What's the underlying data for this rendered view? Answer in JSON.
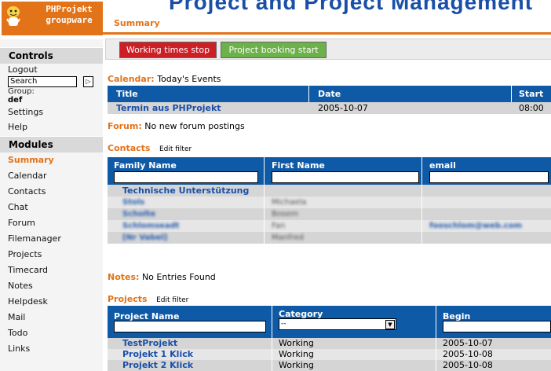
{
  "logo": {
    "line1": "PHProjekt",
    "line2": "groupware"
  },
  "banner": {
    "text": "Project and Project Management"
  },
  "tabs": {
    "active": "Summary"
  },
  "sidebar": {
    "controls_title": "Controls",
    "logout": "Logout",
    "search_value": "Search",
    "search_go": "▷",
    "group_label": "Group:",
    "group_value": "def",
    "settings": "Settings",
    "help": "Help",
    "modules_title": "Modules",
    "modules": [
      "Summary",
      "Calendar",
      "Contacts",
      "Chat",
      "Forum",
      "Filemanager",
      "Projects",
      "Timecard",
      "Notes",
      "Helpdesk",
      "Mail",
      "Todo",
      "Links"
    ],
    "active_module": "Summary"
  },
  "buttons": {
    "stop": "Working times stop",
    "book": "Project booking start"
  },
  "calendar": {
    "label": "Calendar:",
    "subtitle": "Today's Events",
    "headers": [
      "Title",
      "Date",
      "Start"
    ],
    "rows": [
      {
        "title": "Termin aus PHProjekt",
        "date": "2005-10-07",
        "start": "08:00"
      }
    ]
  },
  "forum": {
    "label": "Forum:",
    "text": "No new forum postings"
  },
  "contacts": {
    "label": "Contacts",
    "edit": "Edit filter",
    "headers": [
      "Family Name",
      "First Name",
      "email"
    ],
    "rows": [
      {
        "family": "Technische Unterstützung",
        "first": "",
        "email": ""
      },
      {
        "family": "Stols",
        "first": "Michaela",
        "email": ""
      },
      {
        "family": "Scholte",
        "first": "Bosem",
        "email": ""
      },
      {
        "family": "Schlomseadt",
        "first": "Fan",
        "email": "fooschlom@web.com"
      },
      {
        "family": "[Nr Vabel]",
        "first": "Manfred",
        "email": ""
      }
    ]
  },
  "notes": {
    "label": "Notes:",
    "text": "No Entries Found"
  },
  "projects": {
    "label": "Projects",
    "edit": "Edit filter",
    "headers": [
      "Project Name",
      "Category",
      "Begin"
    ],
    "category_filter": "--",
    "rows": [
      {
        "name": "TestProjekt",
        "category": "Working",
        "begin": "2005-10-07"
      },
      {
        "name": "Projekt 1 Klick",
        "category": "Working",
        "begin": "2005-10-08"
      },
      {
        "name": "Projekt 2 Klick",
        "category": "Working",
        "begin": "2005-10-08"
      }
    ]
  },
  "colors": {
    "accent": "#e37318",
    "header_blue": "#0f5aa7",
    "link_blue": "#1a4fa8",
    "stop_red": "#cc2026",
    "book_green": "#6db14a"
  }
}
